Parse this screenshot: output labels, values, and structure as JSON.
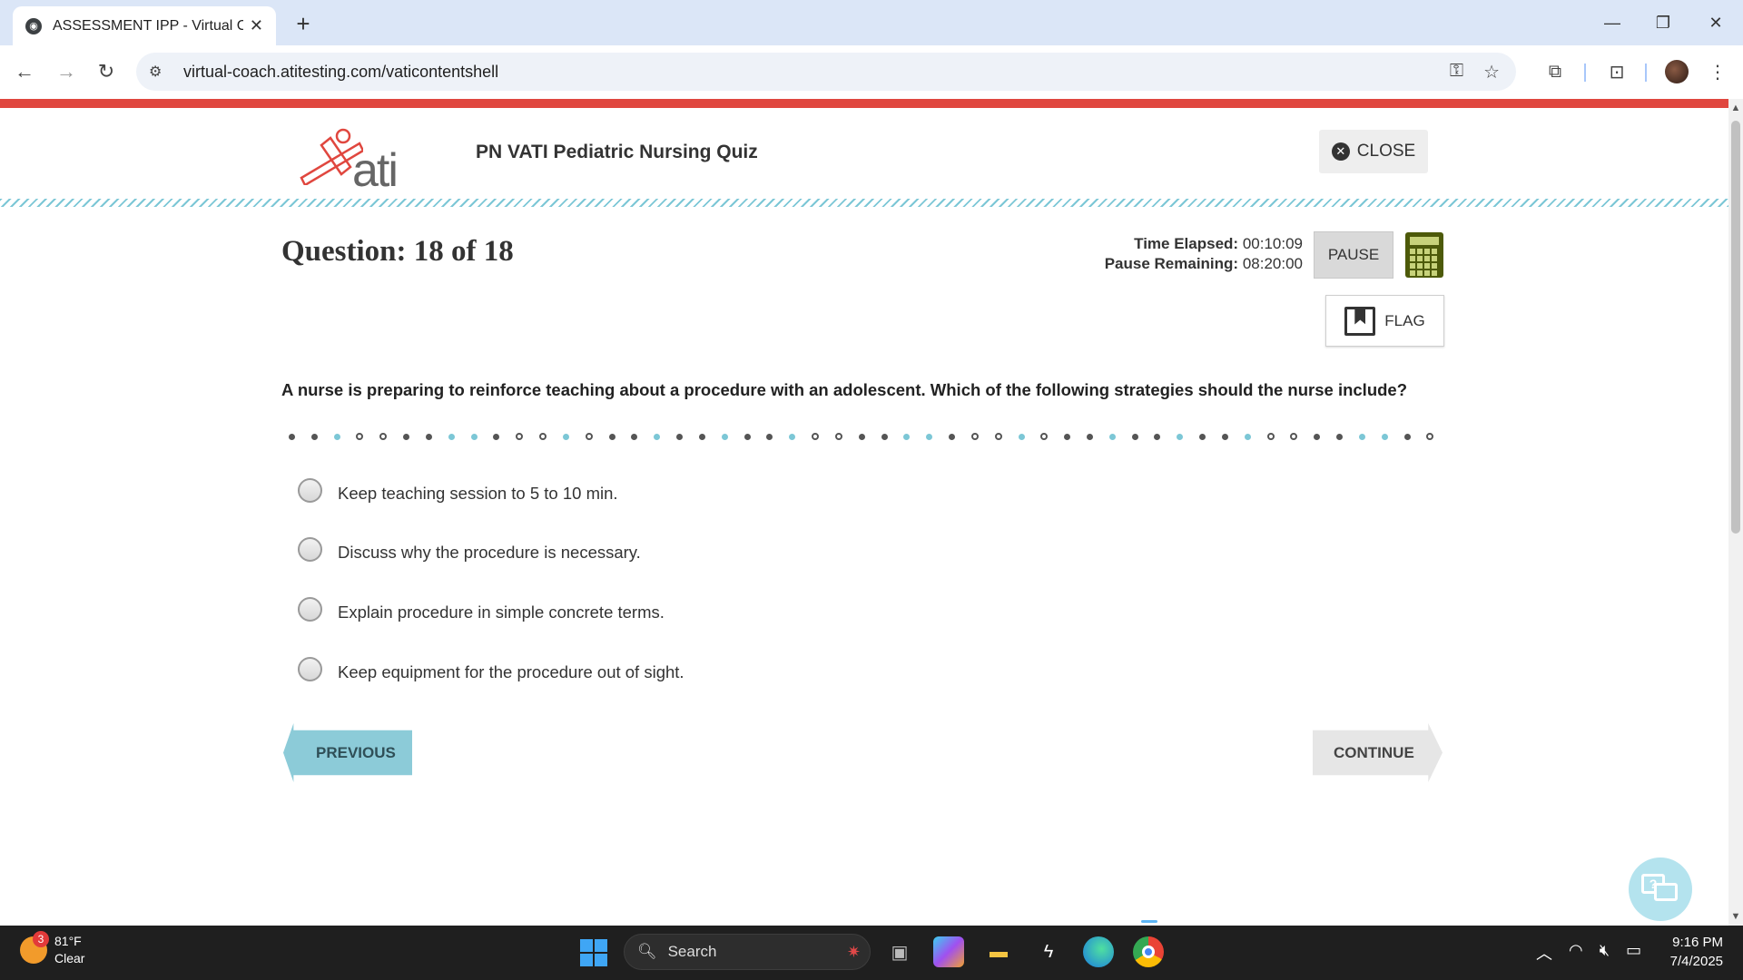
{
  "browser": {
    "tab_title": "ASSESSMENT IPP - Virtual Coac",
    "url": "virtual-coach.atitesting.com/vaticontentshell"
  },
  "header": {
    "logo_text": "ati",
    "quiz_title": "PN VATI Pediatric Nursing Quiz",
    "close_label": "CLOSE"
  },
  "question": {
    "number_label": "Question: 18 of 18",
    "time_elapsed_label": "Time Elapsed:",
    "time_elapsed": "00:10:09",
    "pause_remaining_label": "Pause Remaining:",
    "pause_remaining": "08:20:00",
    "pause_label": "PAUSE",
    "flag_label": "FLAG",
    "text": "A nurse is preparing to reinforce teaching about a procedure with an adolescent. Which of the following strategies should the nurse include?",
    "options": [
      "Keep teaching session to 5 to 10 min.",
      "Discuss why the procedure is necessary.",
      "Explain procedure in simple concrete terms.",
      "Keep equipment for the procedure out of sight."
    ]
  },
  "navigation": {
    "previous_label": "PREVIOUS",
    "continue_label": "CONTINUE"
  },
  "taskbar": {
    "weather_temp": "81°F",
    "weather_desc": "Clear",
    "weather_badge": "3",
    "search_placeholder": "Search",
    "time": "9:16 PM",
    "date": "7/4/2025"
  },
  "colors": {
    "accent_red": "#e0473f",
    "accent_teal": "#7cc7d6",
    "calculator": "#4d5a0a"
  }
}
